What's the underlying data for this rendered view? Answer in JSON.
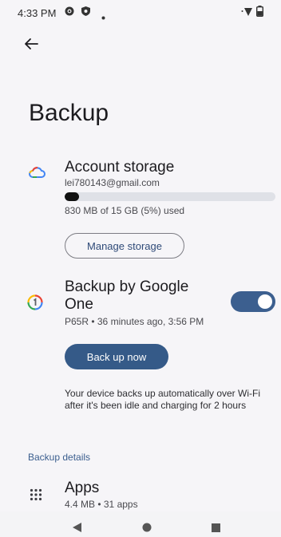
{
  "status_bar": {
    "time": "4:33 PM",
    "icons": [
      "gear-icon",
      "shield-icon",
      "dot-icon",
      "wifi-icon",
      "battery-icon"
    ]
  },
  "page": {
    "title": "Backup"
  },
  "account_storage": {
    "title": "Account storage",
    "email": "lei780143@gmail.com",
    "usage_text": "830 MB of 15 GB (5%) used",
    "usage_fraction": 0.05,
    "manage_button": "Manage storage",
    "icon": "cloud-icon"
  },
  "google_one": {
    "title_line1": "Backup by Google",
    "title_line2": "One",
    "subtitle": "P65R • 36 minutes ago, 3:56 PM",
    "toggle_on": true,
    "backup_button": "Back up now",
    "description": "Your device backs up automatically over Wi-Fi after it's been idle and charging for 2 hours",
    "icon": "google-one-icon"
  },
  "backup_details": {
    "section_title": "Backup details",
    "apps": {
      "title": "Apps",
      "subtitle": "4.4 MB • 31 apps",
      "icon": "apps-grid-icon"
    }
  },
  "nav_bar": {
    "icons": [
      "back-triangle-icon",
      "home-circle-icon",
      "recents-square-icon"
    ]
  },
  "colors": {
    "accent": "#355a88",
    "toggle": "#3c5f8f",
    "section": "#3b5e8e",
    "background": "#f6f5f8"
  }
}
